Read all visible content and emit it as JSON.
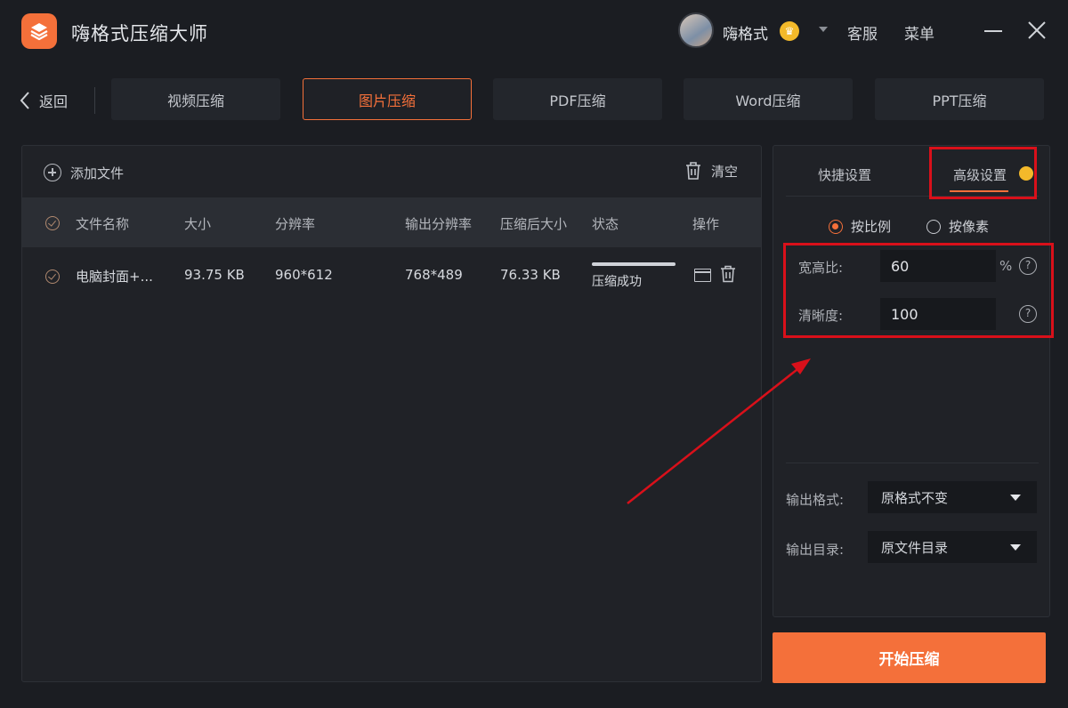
{
  "app": {
    "title": "嗨格式压缩大师",
    "username": "嗨格式",
    "service": "客服",
    "menu": "菜单"
  },
  "colors": {
    "accent": "#f4703a",
    "vip": "#f3b92a",
    "annotation": "#d9101a"
  },
  "nav": {
    "back_label": "返回",
    "tabs": [
      {
        "label": "视频压缩"
      },
      {
        "label": "图片压缩"
      },
      {
        "label": "PDF压缩"
      },
      {
        "label": "Word压缩"
      },
      {
        "label": "PPT压缩"
      }
    ],
    "active_tab": "图片压缩"
  },
  "file_panel": {
    "add_file_label": "添加文件",
    "clear_label": "清空",
    "columns": [
      "文件名称",
      "大小",
      "分辨率",
      "输出分辨率",
      "压缩后大小",
      "状态",
      "操作"
    ],
    "rows": [
      {
        "name": "电脑封面+...",
        "size": "93.75 KB",
        "resolution": "960*612",
        "output_resolution": "768*489",
        "compressed_size": "76.33 KB",
        "status": "压缩成功",
        "progress": 100
      }
    ]
  },
  "settings": {
    "tab_quick": "快捷设置",
    "tab_advanced": "高级设置",
    "radio_ratio": "按比例",
    "radio_pixel": "按像素",
    "ratio_label": "宽高比:",
    "ratio_value": "60",
    "ratio_unit": "%",
    "clarity_label": "清晰度:",
    "clarity_value": "100",
    "help_glyph": "?",
    "output_format_label": "输出格式:",
    "output_format_value": "原格式不变",
    "output_dir_label": "输出目录:",
    "output_dir_value": "原文件目录"
  },
  "start_button": "开始压缩"
}
